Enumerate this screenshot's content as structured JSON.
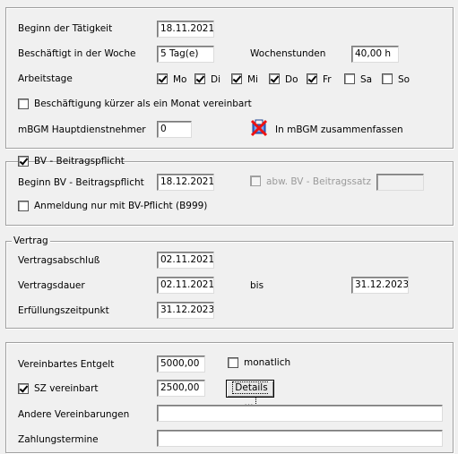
{
  "beschaeftigung": {
    "beginn_label": "Beginn der Tätigkeit",
    "beginn_value": "18.11.2021",
    "beschaeftigt_label": "Beschäftigt in der Woche",
    "beschaeftigt_value": "5 Tag(e)",
    "wochenstunden_label": "Wochenstunden",
    "wochenstunden_value": "40,00  h",
    "arbeitstage_label": "Arbeitstage",
    "days": [
      {
        "label": "Mo",
        "checked": true
      },
      {
        "label": "Di",
        "checked": true
      },
      {
        "label": "Mi",
        "checked": true
      },
      {
        "label": "Do",
        "checked": true
      },
      {
        "label": "Fr",
        "checked": true
      },
      {
        "label": "Sa",
        "checked": false
      },
      {
        "label": "So",
        "checked": false
      }
    ],
    "kurzer_label": "Beschäftigung kürzer als ein Monat vereinbart",
    "kurzer_checked": false,
    "mbgm_label": "mBGM Hauptdienstnehmer",
    "mbgm_value": "0",
    "mbgm_zusammen_label": "In mBGM zusammenfassen",
    "mbgm_icon": "merge-blocked-icon"
  },
  "bv": {
    "title": "BV - Beitragspflicht",
    "title_checked": true,
    "beginn_label": "Beginn BV - Beitragspflicht",
    "beginn_value": "18.12.2021",
    "abw_label": "abw. BV - Beitragssatz",
    "abw_checked": false,
    "abw_value": "",
    "anmeldung_label": "Anmeldung nur mit BV-Pflicht (B999)",
    "anmeldung_checked": false
  },
  "vertrag": {
    "title": "Vertrag",
    "abschluss_label": "Vertragsabschluß",
    "abschluss_value": "02.11.2021",
    "dauer_label": "Vertragsdauer",
    "dauer_von": "02.11.2021",
    "bis_label": "bis",
    "dauer_bis": "31.12.2023",
    "erfuellung_label": "Erfüllungszeitpunkt",
    "erfuellung_value": "31.12.2023"
  },
  "entgelt": {
    "vereinbart_label": "Vereinbartes Entgelt",
    "vereinbart_value": "5000,00",
    "monatlich_label": "monatlich",
    "monatlich_checked": false,
    "sz_label": "SZ vereinbart",
    "sz_checked": true,
    "sz_value": "2500,00",
    "details_label": "Details ...",
    "andere_label": "Andere Vereinbarungen",
    "andere_value": "",
    "zahlung_label": "Zahlungstermine",
    "zahlung_value": ""
  }
}
